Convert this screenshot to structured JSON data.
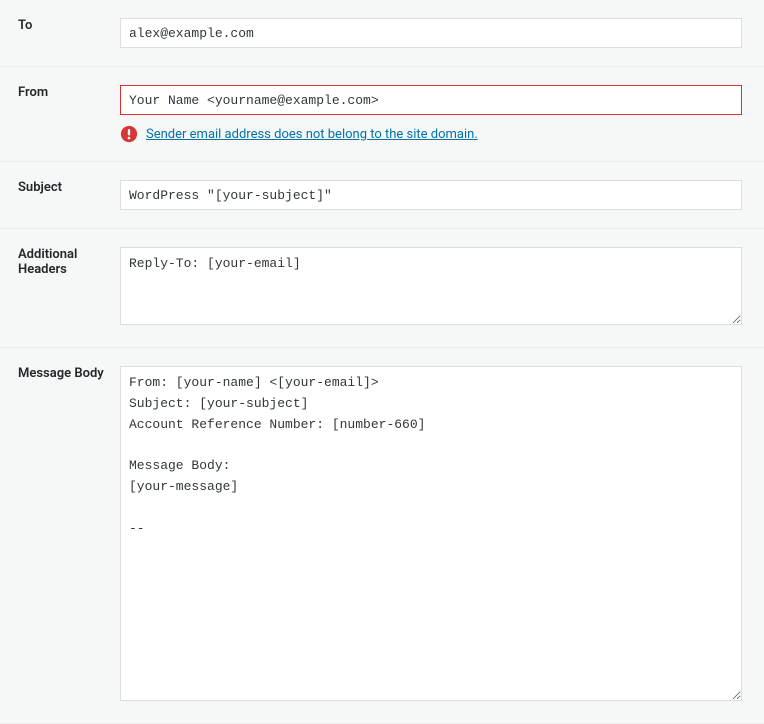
{
  "fields": {
    "to": {
      "label": "To",
      "value": "alex@example.com"
    },
    "from": {
      "label": "From",
      "value": "Your Name <yourname@example.com>",
      "alert": "Sender email address does not belong to the site domain."
    },
    "subject": {
      "label": "Subject",
      "value": "WordPress \"[your-subject]\""
    },
    "additional_headers": {
      "label": "Additional Headers",
      "value": "Reply-To: [your-email]"
    },
    "message_body": {
      "label": "Message Body",
      "value": "From: [your-name] <[your-email]>\nSubject: [your-subject]\nAccount Reference Number: [number-660]\n\nMessage Body:\n[your-message]\n\n--"
    }
  }
}
